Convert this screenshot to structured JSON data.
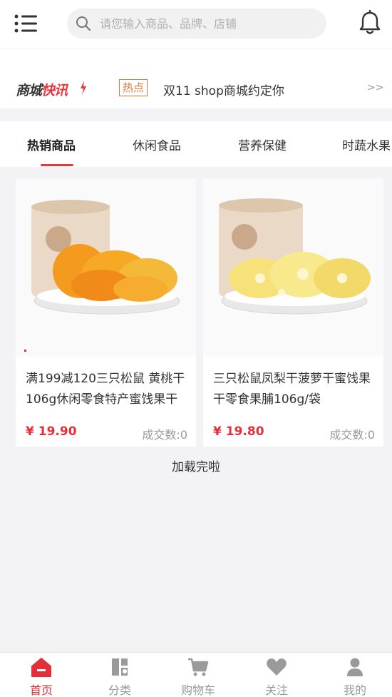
{
  "header": {
    "search_placeholder": "请您输入商品、品牌、店铺"
  },
  "news": {
    "logo_part1": "商城",
    "logo_part2": "快讯",
    "tag": "热点",
    "headline": "双11 shop商城约定你",
    "more": ">>"
  },
  "tabs": [
    {
      "label": "热销商品",
      "active": true
    },
    {
      "label": "休闲食品",
      "active": false
    },
    {
      "label": "营养保健",
      "active": false
    },
    {
      "label": "时蔬水果",
      "active": false
    }
  ],
  "products": [
    {
      "title": "满199减120三只松鼠 黄桃干106g休闲零食特产蜜饯果干",
      "price": "¥ 19.90",
      "sold": "成交数:0"
    },
    {
      "title": "三只松鼠凤梨干菠萝干蜜饯果干零食果脯106g/袋",
      "price": "¥ 19.80",
      "sold": "成交数:0"
    }
  ],
  "status": {
    "loaded": "加载完啦"
  },
  "tabbar": [
    {
      "label": "首页",
      "icon": "home-icon",
      "active": true
    },
    {
      "label": "分类",
      "icon": "category-icon",
      "active": false
    },
    {
      "label": "购物车",
      "icon": "cart-icon",
      "active": false
    },
    {
      "label": "关注",
      "icon": "heart-icon",
      "active": false
    },
    {
      "label": "我的",
      "icon": "user-icon",
      "active": false
    }
  ],
  "colors": {
    "accent": "#e2303b",
    "tag": "#e2783c",
    "background": "#f3f3f5"
  }
}
